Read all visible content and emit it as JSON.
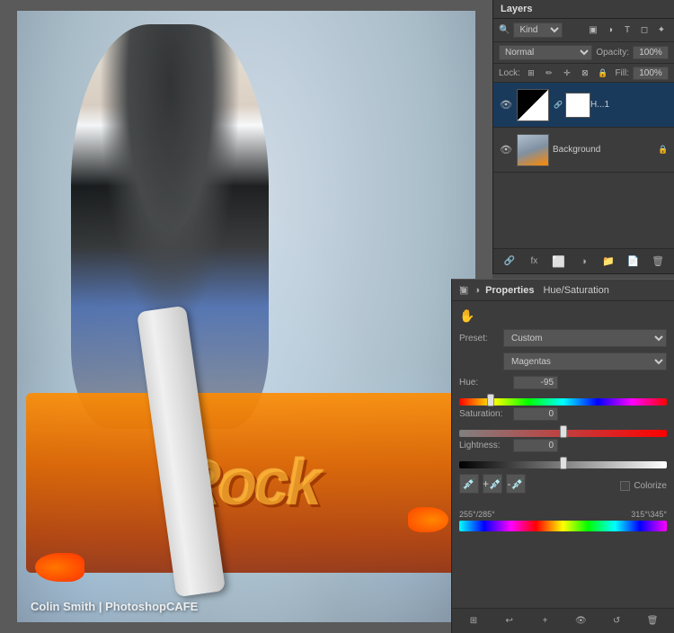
{
  "canvas": {
    "watermark": "Colin Smith | PhotoshopCAFE"
  },
  "layers_panel": {
    "title": "Layers",
    "kind_label": "Kind",
    "blend_mode": "Normal",
    "opacity_label": "Opacity:",
    "opacity_value": "100%",
    "lock_label": "Lock:",
    "fill_label": "Fill:",
    "fill_value": "100%",
    "layers": [
      {
        "name": "H...1",
        "type": "adjustment",
        "visible": true,
        "has_mask": true
      },
      {
        "name": "Background",
        "type": "photo",
        "visible": true,
        "locked": true
      }
    ],
    "footer_icons": [
      "link-icon",
      "fx-icon",
      "mask-icon",
      "adjustment-icon",
      "group-icon",
      "delete-icon"
    ]
  },
  "properties_panel": {
    "title": "Properties",
    "subtitle": "Hue/Saturation",
    "preset_label": "Preset:",
    "preset_value": "Custom",
    "channel_label": "",
    "channel_value": "Magentas",
    "hue_label": "Hue:",
    "hue_value": "-95",
    "saturation_label": "Saturation:",
    "saturation_value": "0",
    "lightness_label": "Lightness:",
    "lightness_value": "0",
    "colorize_label": "Colorize",
    "range_left": "255°/285°",
    "range_right": "315°\\345°",
    "hue_slider_pct": 15,
    "saturation_slider_pct": 50,
    "lightness_slider_pct": 50,
    "footer_icons": [
      "first-frame-icon",
      "prev-frame-icon",
      "add-frame-icon",
      "visibility-icon",
      "reset-icon",
      "delete-icon"
    ]
  }
}
